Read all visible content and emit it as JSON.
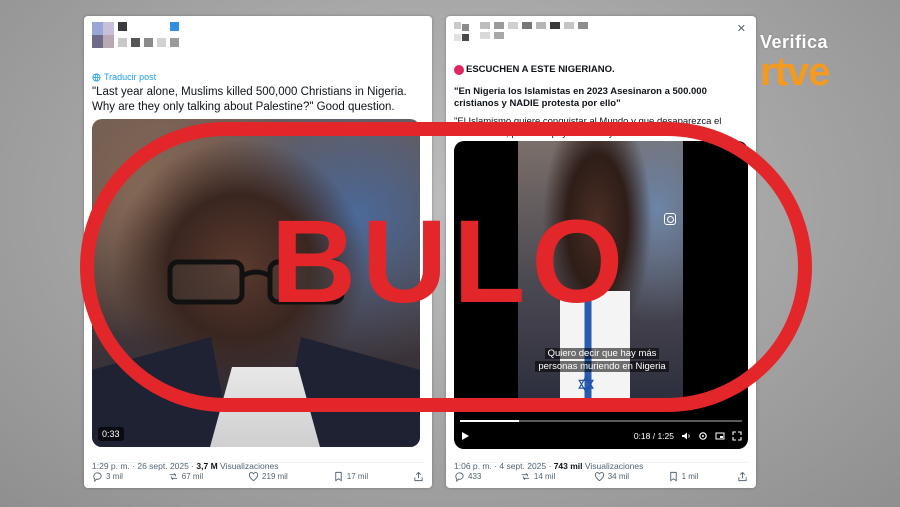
{
  "brand": {
    "verifica": "Verifica",
    "rtve": "rtve"
  },
  "overlay": {
    "stamp_text": "BULO",
    "stamp_color": "#e3262a"
  },
  "left_post": {
    "translate_label": "Traducir post",
    "text": "\"Last year alone, Muslims killed 500,000 Christians in Nigeria. Why are they only talking about Palestine?\" Good question.",
    "video_duration": "0:33",
    "timestamp": "1:29 p. m. · 26 sept. 2025 · ",
    "views_count": "3,7 M",
    "views_label": " Visualizaciones",
    "actions": {
      "replies": "3 mil",
      "reposts": "67 mil",
      "likes": "219 mil",
      "bookmarks": "17 mil"
    }
  },
  "right_post": {
    "heading": "ESCUCHEN A ESTE NIGERIANO.",
    "quote": "\"En Nigeria los Islamistas en 2023 Asesinaron a 500.000 cristianos y NADIE protesta por ello\"",
    "body": "\"El Islamismo quiere conquistar al Mundo y que desaparezca el Cristianismo, por eso Apoyo a Israel y al Pueblo Judío\"",
    "subtitle_line1": "Quiero decir que hay más",
    "subtitle_line2": "personas muriendo en Nigeria",
    "video_time": "0:18 / 1:25",
    "video_progress": 0.21,
    "timestamp": "1:06 p. m. · 4 sept. 2025 · ",
    "views_count": "743 mil",
    "views_label": " Visualizaciones",
    "actions": {
      "replies": "433",
      "reposts": "14 mil",
      "likes": "34 mil",
      "bookmarks": "1 mil"
    }
  },
  "colors": {
    "accent_blue": "#1d9bf0",
    "rtve_orange": "#f39a1f",
    "stamp_red": "#e3262a"
  }
}
